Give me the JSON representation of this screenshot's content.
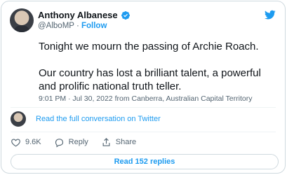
{
  "author": {
    "display_name": "Anthony Albanese",
    "handle": "@AlboMP",
    "separator": "·",
    "follow_label": "Follow"
  },
  "tweet": {
    "paragraphs": [
      "Tonight we mourn the passing of Archie Roach.",
      "Our country has lost a brilliant talent, a powerful and prolific national truth teller."
    ],
    "meta": "9:01 PM · Jul 30, 2022 from Canberra, Australian Capital Territory"
  },
  "conversation_link": "Read the full conversation on Twitter",
  "actions": {
    "like_count": "9.6K",
    "reply_label": "Reply",
    "share_label": "Share"
  },
  "read_replies_label": "Read 152 replies",
  "colors": {
    "accent": "#1d9bf0",
    "text": "#0f1419",
    "muted": "#536471",
    "border": "#cfd9de"
  },
  "icons": [
    "verified-badge-icon",
    "twitter-bird-icon",
    "heart-icon",
    "reply-icon",
    "share-icon"
  ]
}
